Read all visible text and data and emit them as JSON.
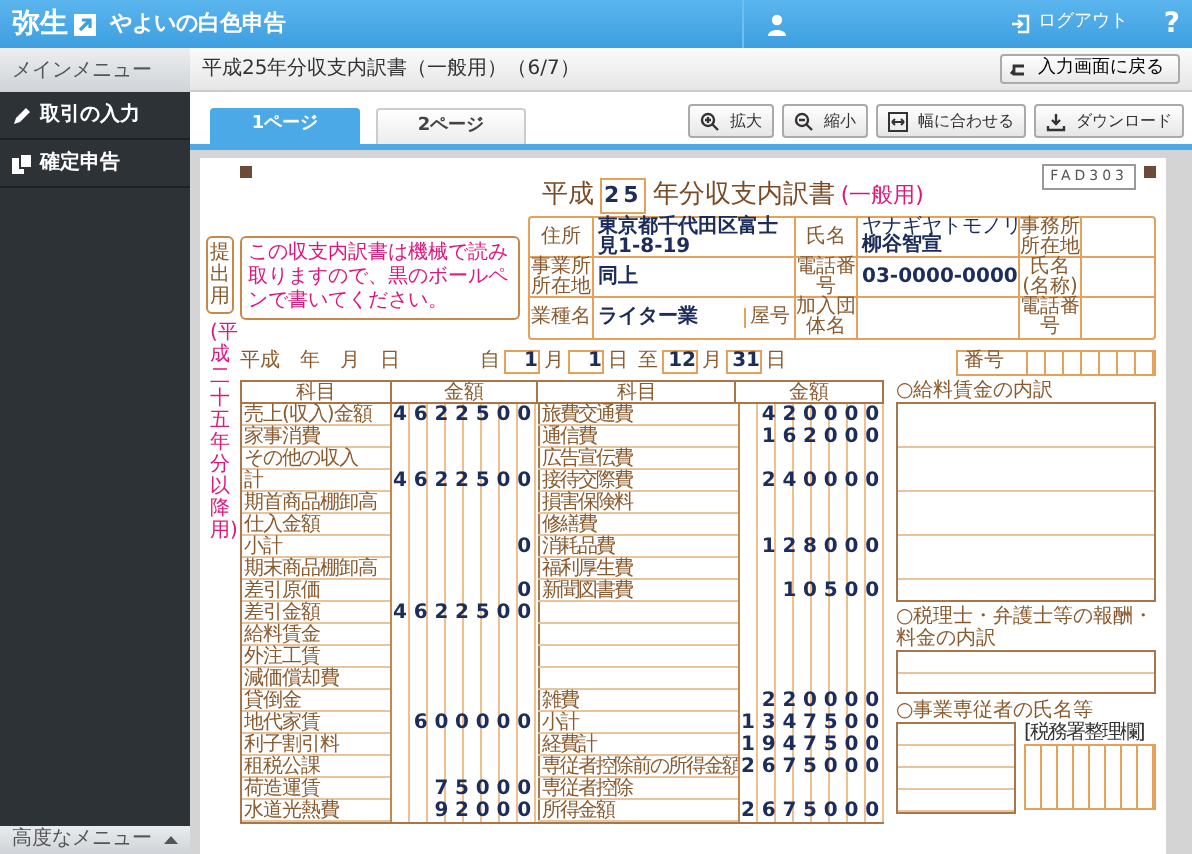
{
  "app": {
    "logo": "弥生",
    "title": "やよいの白色申告",
    "logout": "ログアウト",
    "help": "?"
  },
  "sidebar": {
    "header": "メインメニュー",
    "items": [
      {
        "label": "取引の入力"
      },
      {
        "label": "確定申告"
      }
    ],
    "footer": "高度なメニュー"
  },
  "page": {
    "title": "平成25年分収支内訳書（一般用）（6/7）",
    "back_button": "入力画面に戻る"
  },
  "tabs": [
    {
      "label": "1ページ",
      "selected": true
    },
    {
      "label": "2ページ",
      "selected": false
    }
  ],
  "toolbar": [
    {
      "label": "拡大",
      "kind": "zoom-in"
    },
    {
      "label": "縮小",
      "kind": "zoom-out"
    },
    {
      "label": "幅に合わせる",
      "kind": "fit"
    },
    {
      "label": "ダウンロード",
      "kind": "download"
    }
  ],
  "form": {
    "form_code": "FAD303",
    "submit_label": "提出用",
    "era_note": "(平成二十五年分以降用)",
    "title": {
      "era": "平成",
      "year": "25",
      "name": "年分収支内訳書",
      "variant": "(一般用)"
    },
    "notice": "この収支内訳書は機械で読み取りますので、黒のボールペンで書いてください。",
    "info_rows": [
      [
        {
          "label": "住所",
          "value": "東京都千代田区富士見1-8-19"
        },
        {
          "label": "氏名",
          "reading": "ヤナギヤトモノリ",
          "value": "柳谷智宣"
        },
        {
          "label": "事務所所在地"
        }
      ],
      [
        {
          "label": "事業所所在地",
          "value": "同上"
        },
        {
          "label": "電話番号",
          "value": "03-0000-0000"
        },
        {
          "label": "氏名(名称)"
        }
      ],
      [
        {
          "label": "業種名",
          "value": "ライター業",
          "sub_label": "屋号"
        },
        {
          "label": "加入団体名"
        },
        {
          "label": "電話番号"
        }
      ]
    ],
    "date_label": "平成　年　月　日",
    "period": {
      "from_label": "自",
      "from_month": "1",
      "from_day": "1",
      "to_label": "至",
      "to_month": "12",
      "to_day": "31",
      "from_month_unit": "月",
      "from_day_unit": "日",
      "to_month_unit": "月",
      "to_day_unit": "日"
    },
    "number_label": "番号",
    "table_headers": [
      "科目",
      "金額",
      "科目",
      "金額"
    ],
    "left_rows": [
      {
        "label": "売上(収入)金額",
        "amount": "4622500"
      },
      {
        "label": "家事消費"
      },
      {
        "label": "その他の収入"
      },
      {
        "label": "計",
        "amount": "4622500"
      },
      {
        "label": "期首商品棚卸高"
      },
      {
        "label": "仕入金額"
      },
      {
        "label": "小計",
        "amount": "0"
      },
      {
        "label": "期末商品棚卸高"
      },
      {
        "label": "差引原価",
        "amount": "0"
      },
      {
        "label": "差引金額",
        "amount": "4622500"
      },
      {
        "label": "給料賃金"
      },
      {
        "label": "外注工賃"
      },
      {
        "label": "減価償却費"
      },
      {
        "label": "貸倒金"
      },
      {
        "label": "地代家賃",
        "amount": "600000"
      },
      {
        "label": "利子割引料"
      },
      {
        "label": "租税公課"
      },
      {
        "label": "荷造運賃",
        "amount": "75000"
      },
      {
        "label": "水道光熱費",
        "amount": "92000"
      }
    ],
    "right_rows": [
      {
        "label": "旅費交通費",
        "amount": "420000"
      },
      {
        "label": "通信費",
        "amount": "162000"
      },
      {
        "label": "広告宣伝費"
      },
      {
        "label": "接待交際費",
        "amount": "240000"
      },
      {
        "label": "損害保険料"
      },
      {
        "label": "修繕費"
      },
      {
        "label": "消耗品費",
        "amount": "128000"
      },
      {
        "label": "福利厚生費"
      },
      {
        "label": "新聞図書費",
        "amount": "10500"
      },
      {},
      {},
      {},
      {},
      {
        "label": "雑費",
        "amount": "220000"
      },
      {
        "label": "小計",
        "amount": "1347500"
      },
      {
        "label": "経費計",
        "amount": "1947500"
      },
      {
        "label": "専従者控除前の所得金額",
        "amount": "2675000"
      },
      {
        "label": "専従者控除"
      },
      {
        "label": "所得金額",
        "amount": "2675000"
      }
    ],
    "sections": {
      "salary": "○給料賃金の内訳",
      "fees": "○税理士・弁護士等の報酬・料金の内訳",
      "family": "○事業専従者の氏名等",
      "office": "[税務署整理欄]"
    }
  }
}
